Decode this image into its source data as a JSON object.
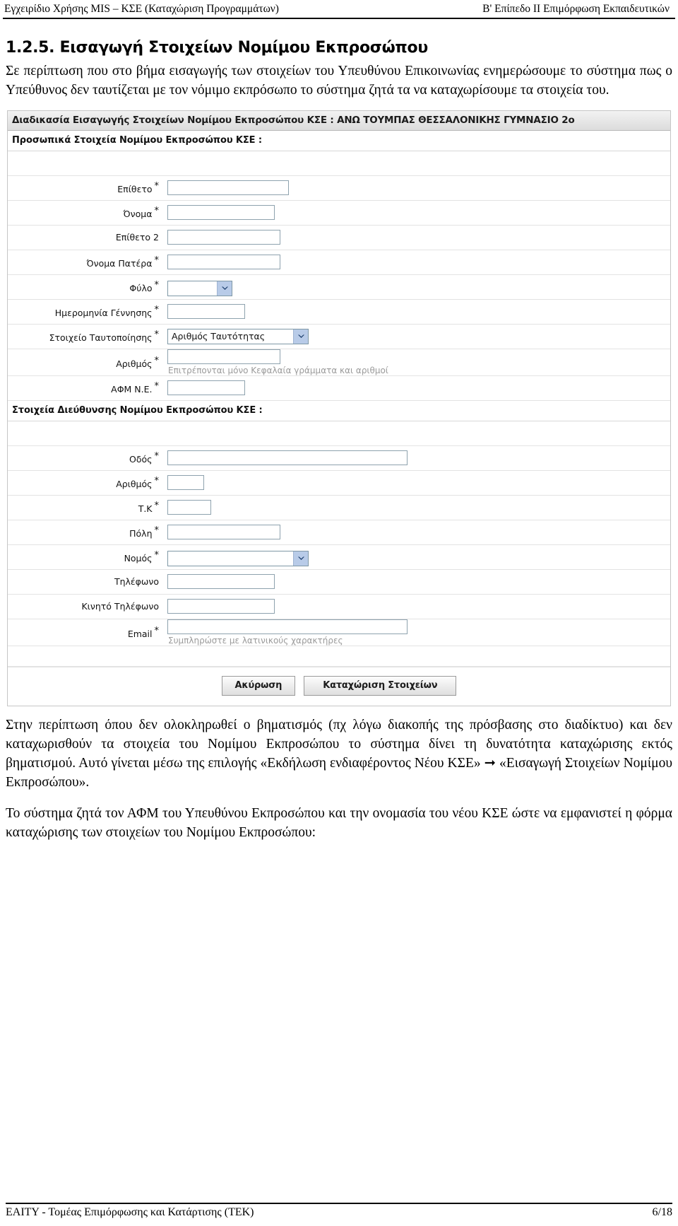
{
  "running_header": {
    "left": "Εγχειρίδιο Χρήσης MIS – ΚΣΕ (Καταχώριση Προγραμμάτων)",
    "right": "Β' Επίπεδο ΙΙ Επιμόρφωση Εκπαιδευτικών"
  },
  "section": {
    "number_title": "1.2.5. Εισαγωγή Στοιχείων Νομίμου Εκπροσώπου",
    "intro_paragraph": "Σε περίπτωση που στο βήμα εισαγωγής των στοιχείων του Υπευθύνου Επικοινωνίας ενημερώσουμε το σύστημα πως ο Υπεύθυνος δεν ταυτίζεται με τον νόμιμο εκπρόσωπο το σύστημα ζητά τα να καταχωρίσουμε τα στοιχεία του."
  },
  "screenshot": {
    "window_title": "Διαδικασία Εισαγωγής Στοιχείων Νομίμου Εκπροσώπου ΚΣΕ : ΑΝΩ ΤΟΥΜΠΑΣ ΘΕΣΣΑΛΟΝΙΚΗΣ ΓΥΜΝΑΣΙΟ 2ο",
    "personal_section_title": "Προσωπικά Στοιχεία Νομίμου Εκπροσώπου ΚΣΕ :",
    "address_section_title": "Στοιχεία Διεύθυνσης Νομίμου Εκπροσώπου ΚΣΕ :",
    "required_mark": "*",
    "personal_fields": [
      {
        "label": "Επίθετο",
        "required": true,
        "type": "text",
        "value": "",
        "width": "w-l"
      },
      {
        "label": "Όνομα",
        "required": true,
        "type": "text",
        "value": "",
        "width": "w-m"
      },
      {
        "label": "Επίθετο 2",
        "required": false,
        "type": "text",
        "value": "",
        "width": "w-ml"
      },
      {
        "label": "Όνομα Πατέρα",
        "required": true,
        "type": "text",
        "value": "",
        "width": "w-ml"
      },
      {
        "label": "Φύλο",
        "required": true,
        "type": "select",
        "value": "",
        "width": "w-s"
      },
      {
        "label": "Ημερομηνία Γέννησης",
        "required": true,
        "type": "text",
        "value": "",
        "width": "w-sm"
      },
      {
        "label": "Στοιχείο Ταυτοποίησης",
        "required": true,
        "type": "select",
        "value": "Αριθμός Ταυτότητας",
        "width": "w-xl"
      },
      {
        "label": "Αριθμός",
        "required": true,
        "type": "text",
        "value": "",
        "width": "w-ml",
        "hint": "Επιτρέπονται μόνο Κεφαλαία γράμματα και αριθμοί"
      },
      {
        "label": "ΑΦΜ Ν.Ε.",
        "required": true,
        "type": "text",
        "value": "",
        "width": "w-sm"
      }
    ],
    "address_fields": [
      {
        "label": "Οδός",
        "required": true,
        "type": "text",
        "value": "",
        "width": "w-xxl"
      },
      {
        "label": "Αριθμός",
        "required": true,
        "type": "text",
        "value": "",
        "width": "w-xxs"
      },
      {
        "label": "Τ.Κ",
        "required": true,
        "type": "text",
        "value": "",
        "width": "w-xs"
      },
      {
        "label": "Πόλη",
        "required": true,
        "type": "text",
        "value": "",
        "width": "w-ml"
      },
      {
        "label": "Νομός",
        "required": true,
        "type": "select",
        "value": "",
        "width": "w-xl"
      },
      {
        "label": "Τηλέφωνο",
        "required": false,
        "type": "text",
        "value": "",
        "width": "w-m"
      },
      {
        "label": "Κινητό Τηλέφωνο",
        "required": false,
        "type": "text",
        "value": "",
        "width": "w-m"
      },
      {
        "label": "Email",
        "required": true,
        "type": "text",
        "value": "",
        "width": "w-xxl",
        "hint": "Συμπληρώστε με λατινικούς χαρακτήρες"
      }
    ],
    "buttons": {
      "cancel": "Ακύρωση",
      "submit": "Καταχώριση Στοιχείων"
    },
    "dropdown_icon": "chevron-down-icon"
  },
  "body_text": {
    "paragraph_1": "Στην περίπτωση όπου δεν ολοκληρωθεί ο βηματισμός (πχ λόγω διακοπής της πρόσβασης στο διαδίκτυο) και δεν καταχωρισθούν τα στοιχεία του Νομίμου Εκπροσώπου το σύστημα δίνει τη δυνατότητα καταχώρισης εκτός βηματισμού. Αυτό γίνεται μέσω της επιλογής «Εκδήλωση ενδιαφέροντος Νέου ΚΣΕ» ➞ «Εισαγωγή Στοιχείων Νομίμου Εκπροσώπου».",
    "paragraph_2": "Το σύστημα ζητά τον ΑΦΜ του Υπευθύνου Εκπροσώπου και την ονομασία του νέου ΚΣΕ ώστε να εμφανιστεί η φόρμα καταχώρισης των στοιχείων του Νομίμου Εκπροσώπου:"
  },
  "footer": {
    "left": "ΕΑΙΤΥ - Τομέας Επιμόρφωσης και Κατάρτισης (ΤΕΚ)",
    "right": "6/18"
  }
}
